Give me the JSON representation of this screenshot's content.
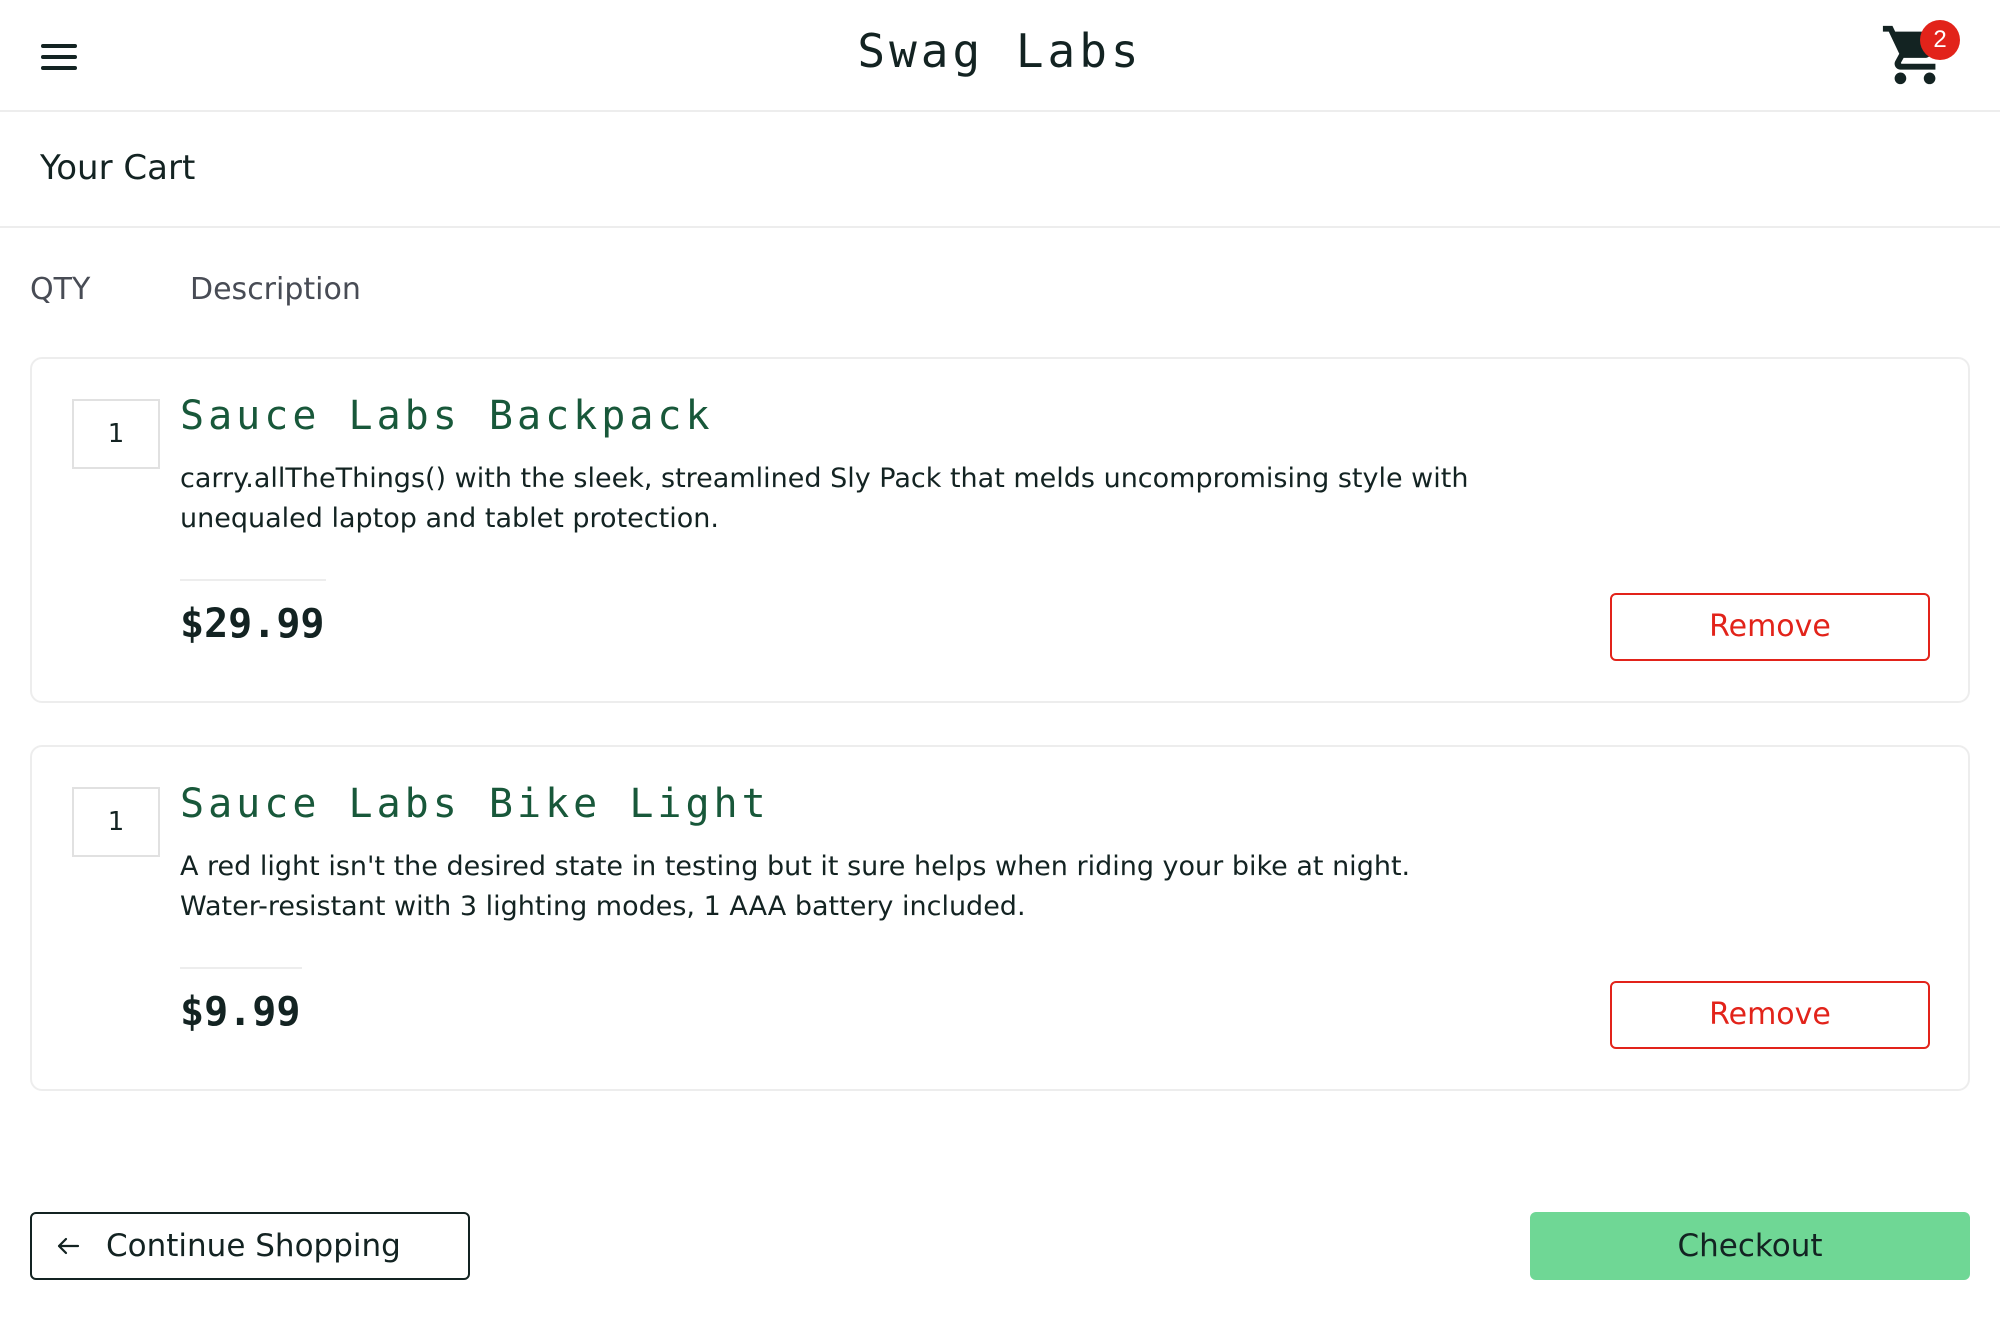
{
  "header": {
    "app_title": "Swag Labs",
    "menu_icon": "hamburger-menu-icon",
    "cart_icon": "shopping-cart-icon",
    "cart_badge_count": "2"
  },
  "page": {
    "title": "Your Cart"
  },
  "columns": {
    "qty_label": "QTY",
    "description_label": "Description"
  },
  "cart_items": [
    {
      "quantity": "1",
      "name": "Sauce Labs Backpack",
      "description": "carry.allTheThings() with the sleek, streamlined Sly Pack that melds uncompromising style with unequaled laptop and tablet protection.",
      "price": "$29.99",
      "remove_label": "Remove"
    },
    {
      "quantity": "1",
      "name": "Sauce Labs Bike Light",
      "description": "A red light isn't the desired state in testing but it sure helps when riding your bike at night. Water-resistant with 3 lighting modes, 1 AAA battery included.",
      "price": "$9.99",
      "remove_label": "Remove"
    }
  ],
  "footer": {
    "continue_label": "Continue Shopping",
    "continue_icon": "arrow-left-icon",
    "checkout_label": "Checkout"
  },
  "colors": {
    "accent_green": "#6fd795",
    "product_name_green": "#18583a",
    "remove_red": "#e2231a",
    "badge_red": "#e2231a",
    "text_dark": "#132322"
  }
}
